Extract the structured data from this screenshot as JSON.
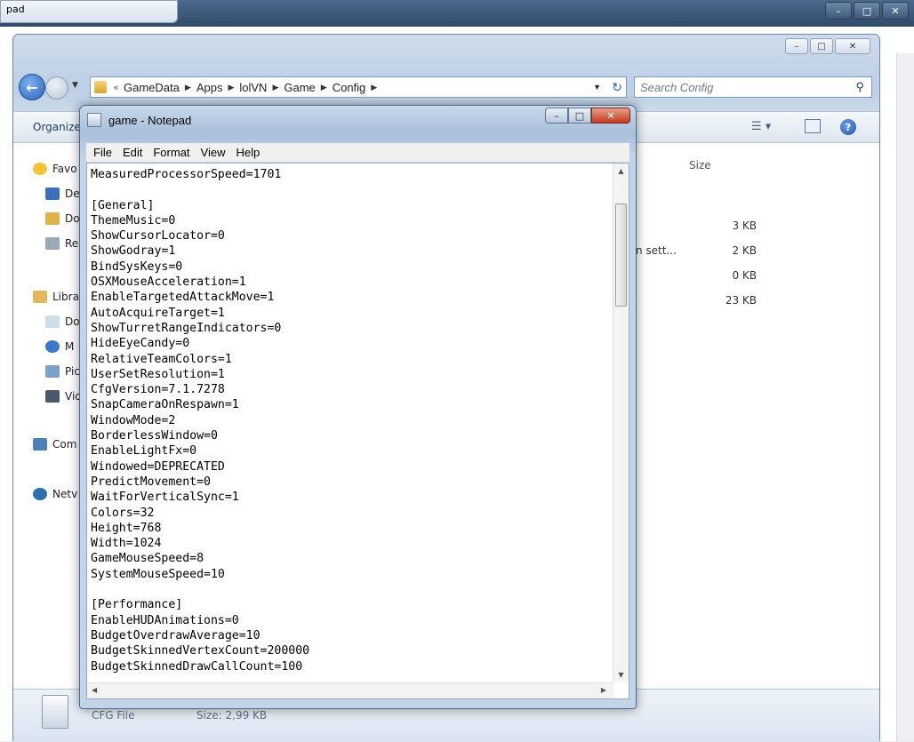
{
  "browser": {
    "tab_title": "pad"
  },
  "explorer": {
    "address_crumbs": [
      "GameData",
      "Apps",
      "lolVN",
      "Game",
      "Config"
    ],
    "search_placeholder": "Search Config",
    "toolbar_organize": "Organize",
    "nav_items": [
      "Favo",
      "De",
      "Do",
      "Re",
      "Libra",
      "Do",
      "M",
      "Pic",
      "Vid",
      "Com",
      "Netv"
    ],
    "column_size": "Size",
    "files": [
      {
        "name": "",
        "size": "3 KB"
      },
      {
        "name": "n sett...",
        "size": "2 KB"
      },
      {
        "name": "",
        "size": "0 KB"
      },
      {
        "name": "",
        "size": "23 KB"
      }
    ],
    "details_type": "CFG File",
    "details_size": "Size: 2,99 KB"
  },
  "notepad": {
    "title": "game - Notepad",
    "menu": [
      "File",
      "Edit",
      "Format",
      "View",
      "Help"
    ],
    "lines": [
      "MeasuredProcessorSpeed=1701",
      "",
      "[General]",
      "ThemeMusic=0",
      "ShowCursorLocator=0",
      "ShowGodray=1",
      "BindSysKeys=0",
      "OSXMouseAcceleration=1",
      "EnableTargetedAttackMove=1",
      "AutoAcquireTarget=1",
      "ShowTurretRangeIndicators=0",
      "HideEyeCandy=0",
      "RelativeTeamColors=1",
      "UserSetResolution=1",
      "CfgVersion=7.1.7278",
      "SnapCameraOnRespawn=1",
      "WindowMode=2",
      "BorderlessWindow=0",
      "EnableLightFx=0",
      "Windowed=DEPRECATED",
      "PredictMovement=0",
      "WaitForVerticalSync=1",
      "Colors=32",
      "Height=768",
      "Width=1024",
      "GameMouseSpeed=8",
      "SystemMouseSpeed=10",
      "",
      "[Performance]",
      "EnableHUDAnimations=0",
      "BudgetOverdrawAverage=10",
      "BudgetSkinnedVertexCount=200000",
      "BudgetSkinnedDrawCallCount=100"
    ]
  }
}
